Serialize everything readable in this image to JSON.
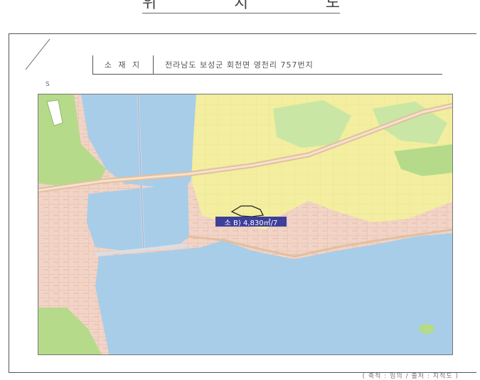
{
  "document": {
    "title_chars": [
      "위",
      "치",
      "도"
    ],
    "location_label": "소 재 지",
    "location_value": "전라남도 보성군 회천면 영천리 757번지",
    "scale_mark": "S",
    "footer_note": "( 축척 : 임의 / 출처 : 지적도 )"
  },
  "map": {
    "area_label": "소 B) 4,830㎡/7",
    "colors": {
      "water": "#a8cde8",
      "urban": "#f2d4c6",
      "hills": "#f3eea0",
      "park": "#b5db8a",
      "forest": "#c9e6a4",
      "road": "#e9c9a6",
      "block_line": "#d9b3a3",
      "label_bg": "#3d3f9a"
    }
  }
}
